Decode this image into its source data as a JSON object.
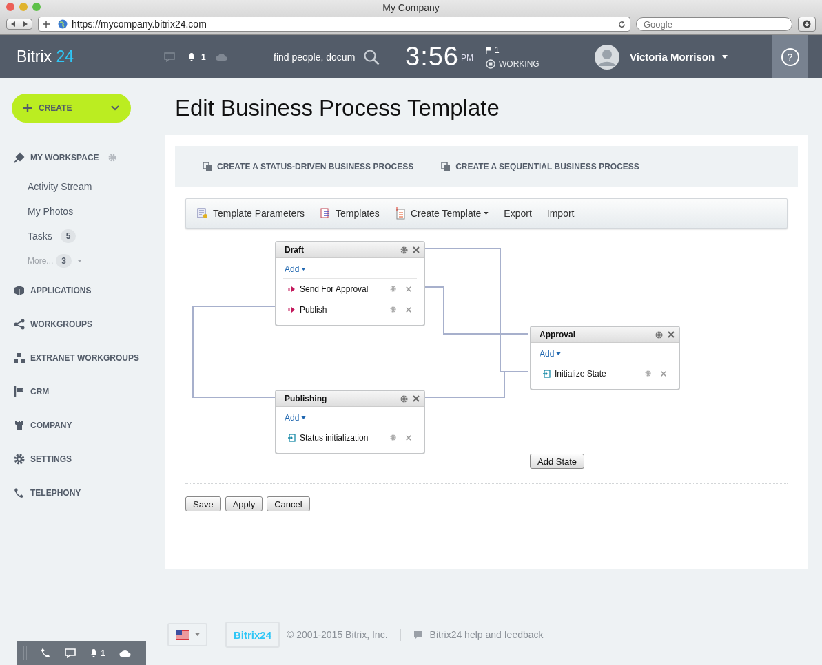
{
  "browser": {
    "title": "My Company",
    "url": "https://mycompany.bitrix24.com",
    "search_placeholder": "Google"
  },
  "header": {
    "logo": "Bitrix",
    "logo_accent": "24",
    "notifications": "1",
    "search_placeholder": "find people, docum",
    "time": "3:56",
    "ampm": "PM",
    "flag_count": "1",
    "status": "WORKING",
    "user": "Victoria Morrison",
    "help": "?"
  },
  "sidebar": {
    "create": "CREATE",
    "workspace": "MY WORKSPACE",
    "workspace_items": [
      {
        "label": "Activity Stream",
        "kind": "link"
      },
      {
        "label": "My Photos",
        "kind": "link"
      },
      {
        "label": "Tasks",
        "kind": "link",
        "count": "5"
      },
      {
        "label": "More...",
        "kind": "more",
        "count": "3"
      }
    ],
    "sections": [
      "APPLICATIONS",
      "WORKGROUPS",
      "EXTRANET WORKGROUPS",
      "CRM",
      "COMPANY",
      "SETTINGS",
      "TELEPHONY"
    ]
  },
  "page_title": "Edit Business Process Template",
  "action_links": [
    "CREATE A STATUS-DRIVEN BUSINESS PROCESS",
    "CREATE A SEQUENTIAL BUSINESS PROCESS"
  ],
  "toolbar": [
    {
      "label": "Template Parameters",
      "kind": "params"
    },
    {
      "label": "Templates",
      "kind": "templates"
    },
    {
      "label": "Create Template",
      "kind": "create"
    },
    {
      "label": "Export",
      "kind": "plain"
    },
    {
      "label": "Import",
      "kind": "plain"
    }
  ],
  "states": [
    {
      "title": "Draft",
      "add": "Add",
      "actions": [
        {
          "label": "Send For Approval",
          "kind": "command"
        },
        {
          "label": "Publish",
          "kind": "command"
        }
      ]
    },
    {
      "title": "Approval",
      "add": "Add",
      "actions": [
        {
          "label": "Initialize State",
          "kind": "init"
        }
      ]
    },
    {
      "title": "Publishing",
      "add": "Add",
      "actions": [
        {
          "label": "Status initialization",
          "kind": "init"
        }
      ]
    }
  ],
  "add_state": "Add State",
  "buttons": [
    "Save",
    "Apply",
    "Cancel"
  ],
  "footer": {
    "logo": "Bitrix24",
    "copyright": "© 2001-2015 Bitrix, Inc.",
    "help": "Bitrix24 help and feedback"
  },
  "bottom_bar": {
    "notifications": "1"
  }
}
